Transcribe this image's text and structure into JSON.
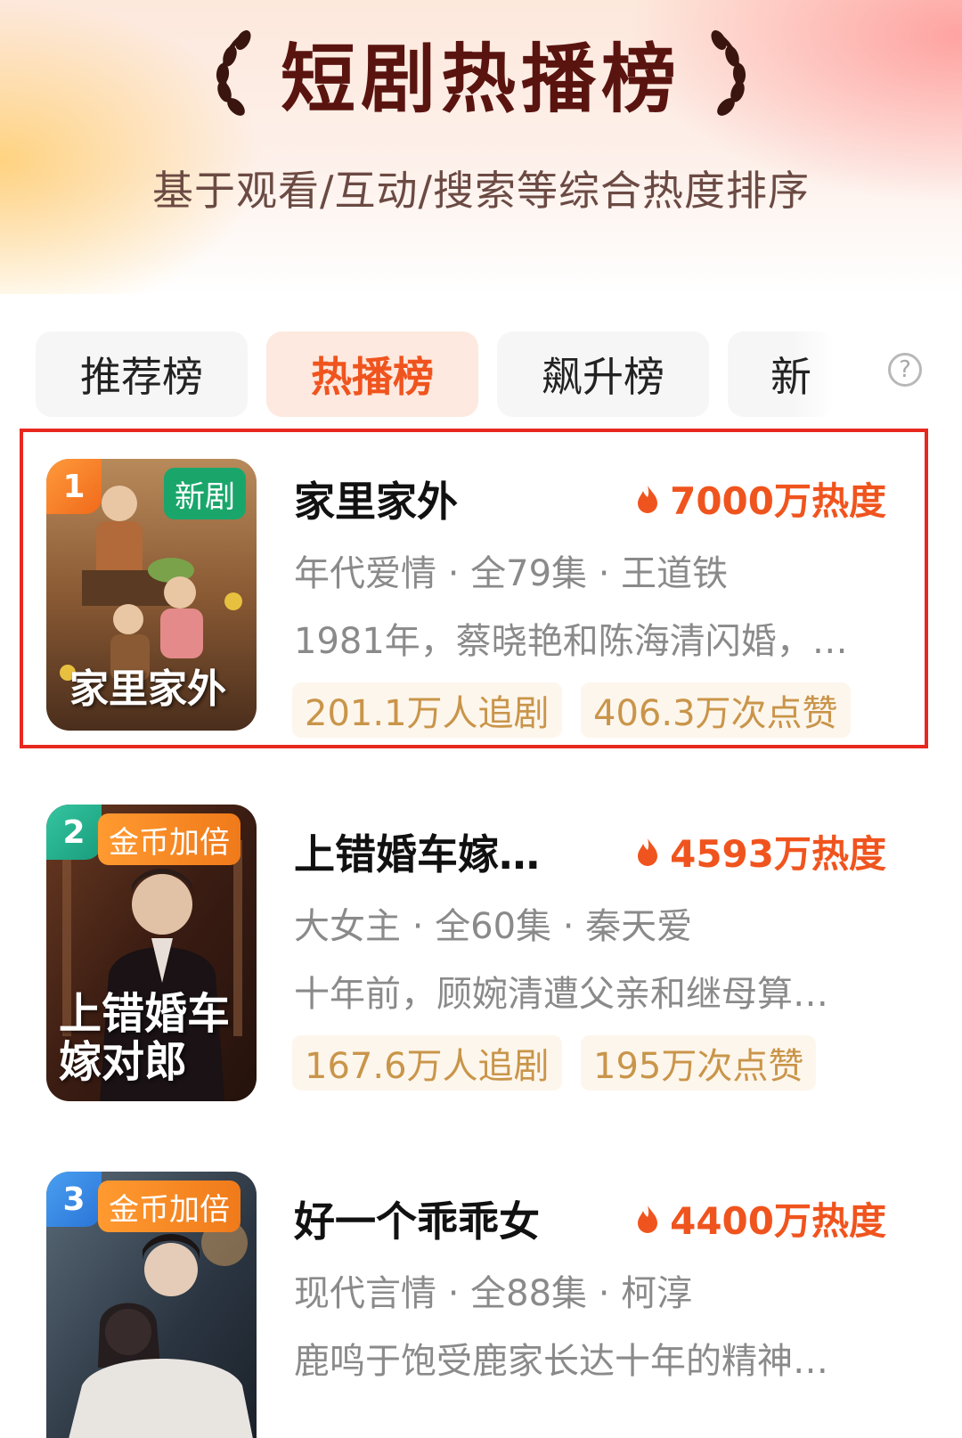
{
  "header": {
    "title": "短剧热播榜",
    "subtitle": "基于观看/互动/搜索等综合热度排序"
  },
  "tabs": [
    {
      "label": "推荐榜",
      "active": false
    },
    {
      "label": "热播榜",
      "active": true
    },
    {
      "label": "飙升榜",
      "active": false
    },
    {
      "label": "新",
      "active": false
    }
  ],
  "help_icon": "question-circle-icon",
  "colors": {
    "accent": "#f0541e",
    "title": "#5a1410",
    "stat_text": "#c9954a",
    "highlight": "#e8281e"
  },
  "items": [
    {
      "rank": "1",
      "badge": "新剧",
      "cover_title": "家里家外",
      "name": "家里家外",
      "heat": "7000万热度",
      "meta": "年代爱情 · 全79集 · 王道铁",
      "desc": "1981年，蔡晓艳和陈海清闪婚，…",
      "followers": "201.1万人追剧",
      "likes": "406.3万次点赞"
    },
    {
      "rank": "2",
      "badge": "金币加倍",
      "cover_title": "上错婚车嫁对郎",
      "name": "上错婚车嫁…",
      "heat": "4593万热度",
      "meta": "大女主 · 全60集 · 秦天爱",
      "desc": "十年前，顾婉清遭父亲和继母算…",
      "followers": "167.6万人追剧",
      "likes": "195万次点赞"
    },
    {
      "rank": "3",
      "badge": "金币加倍",
      "cover_title": "",
      "name": "好一个乖乖女",
      "heat": "4400万热度",
      "meta": "现代言情 · 全88集 · 柯淳",
      "desc": "鹿鸣于饱受鹿家长达十年的精神…"
    }
  ]
}
